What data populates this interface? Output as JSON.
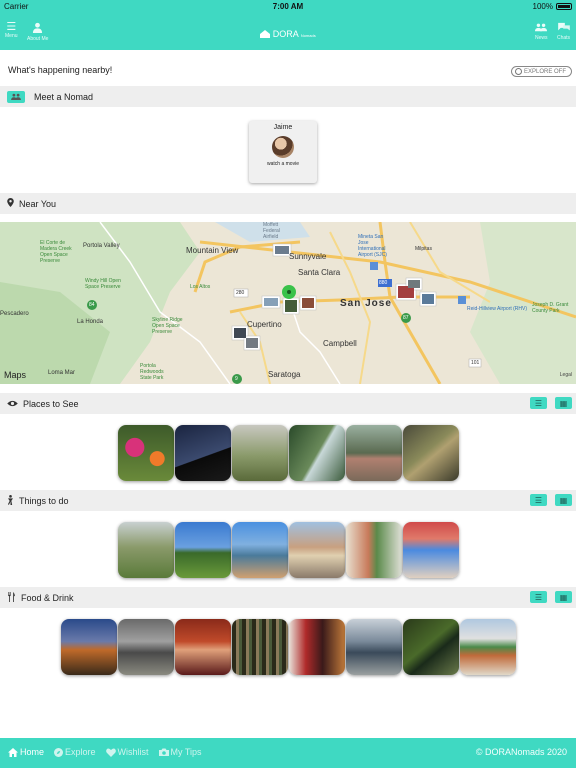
{
  "status": {
    "carrier": "Carrier",
    "time": "7:00 AM",
    "battery": "100%"
  },
  "nav": {
    "menu": "Menu",
    "about": "About Me",
    "brand": "DORA",
    "brand_sub": "Nomads",
    "news": "News",
    "chats": "Chats"
  },
  "happening": "What's happening nearby!",
  "explore_toggle": "EXPLORE OFF",
  "sections": {
    "meet": "Meet a Nomad",
    "near": "Near You",
    "places": "Places to See",
    "things": "Things to do",
    "food": "Food & Drink"
  },
  "nomad": {
    "name": "Jaime",
    "activity": "watch a movie"
  },
  "map": {
    "brand": "Maps",
    "legal": "Legal",
    "labels": [
      "Mountain View",
      "Sunnyvale",
      "Santa Clara",
      "San Jose",
      "Cupertino",
      "Campbell",
      "Saratoga",
      "Los Altos",
      "Portola Valley",
      "Loma Mar",
      "La Honda",
      "Pescadero",
      "Milpitas",
      "Reid-Hillview Airport (RHV)",
      "Joseph D. Grant County Park",
      "Skyline Ridge Open Space Preserve",
      "Portola Redwoods State Park",
      "El Corte de Madera Creek Open Space Preserve",
      "Windy Hill Open Space Preserve",
      "Moffett Federal Airfield",
      "Mineta San Jose International Airport (SJC)"
    ],
    "shields": [
      "280",
      "880",
      "101",
      "87",
      "84",
      "9"
    ]
  },
  "footer": {
    "home": "Home",
    "explore": "Explore",
    "wishlist": "Wishlist",
    "mytips": "My Tips",
    "copyright": "© DORANomads 2020"
  },
  "colors": {
    "accent": "#3fd9c2",
    "section_bg": "#eeeeee"
  },
  "icons": {
    "menu": "menu-icon",
    "about": "user-icon",
    "news": "group-icon",
    "chats": "chat-icon",
    "places": "eye-icon",
    "things": "figure-icon",
    "food": "utensils-icon",
    "near": "pin-icon"
  }
}
